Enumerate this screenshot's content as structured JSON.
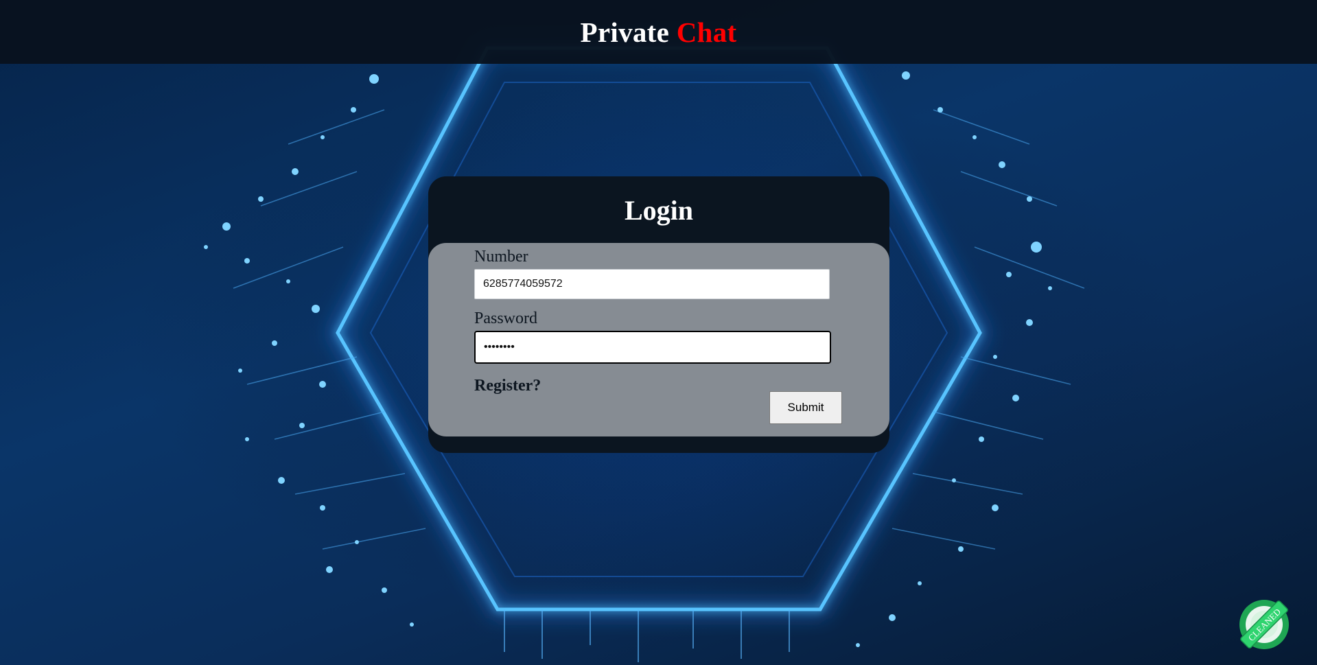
{
  "header": {
    "brand_part1": "Private ",
    "brand_part2": "Chat"
  },
  "login": {
    "title": "Login",
    "number_label": "Number",
    "number_value": "6285774059572",
    "password_label": "Password",
    "password_value": "12345678",
    "register_label": "Register?",
    "submit_label": "Submit"
  },
  "badge": {
    "text": "CLEANED"
  },
  "colors": {
    "accent": "#ff0000",
    "header_bg": "#08121e",
    "card_bg": "#0b1520",
    "card_body_bg": "#868c93",
    "glow": "#3fb4ff",
    "badge_green": "#2fd46f"
  }
}
